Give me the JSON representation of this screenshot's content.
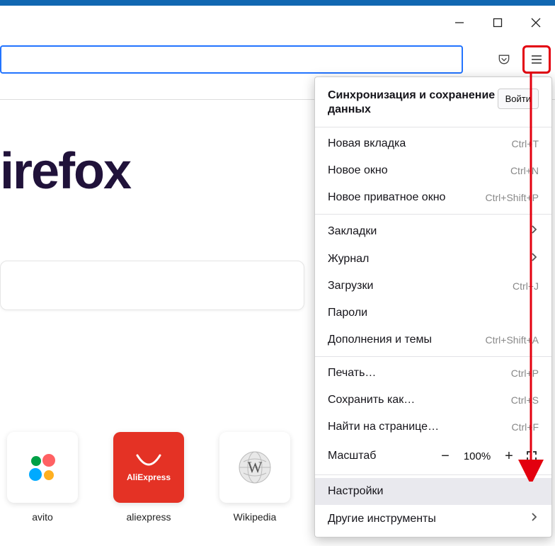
{
  "window_controls": {
    "minimize": "minimize",
    "maximize": "maximize",
    "close": "close"
  },
  "toolbar_icons": {
    "pocket": "pocket-icon",
    "menu": "hamburger-icon"
  },
  "logo_text": "irefox",
  "shortcuts": [
    {
      "label": "avito",
      "icon": "avito"
    },
    {
      "label": "aliexpress",
      "icon": "aliexpress"
    },
    {
      "label": "Wikipedia",
      "icon": "wikipedia"
    }
  ],
  "menu": {
    "sync_title": "Синхронизация и сохранение данных",
    "login_btn": "Войти",
    "items1": [
      {
        "label": "Новая вкладка",
        "shortcut": "Ctrl+T"
      },
      {
        "label": "Новое окно",
        "shortcut": "Ctrl+N"
      },
      {
        "label": "Новое приватное окно",
        "shortcut": "Ctrl+Shift+P"
      }
    ],
    "items2": [
      {
        "label": "Закладки",
        "arrow": true
      },
      {
        "label": "Журнал",
        "arrow": true
      },
      {
        "label": "Загрузки",
        "shortcut": "Ctrl+J"
      },
      {
        "label": "Пароли"
      },
      {
        "label": "Дополнения и темы",
        "shortcut": "Ctrl+Shift+A"
      }
    ],
    "items3": [
      {
        "label": "Печать…",
        "shortcut": "Ctrl+P"
      },
      {
        "label": "Сохранить как…",
        "shortcut": "Ctrl+S"
      },
      {
        "label": "Найти на странице…",
        "shortcut": "Ctrl+F"
      }
    ],
    "zoom": {
      "label": "Масштаб",
      "value": "100%"
    },
    "settings": "Настройки",
    "more_tools": "Другие инструменты"
  }
}
